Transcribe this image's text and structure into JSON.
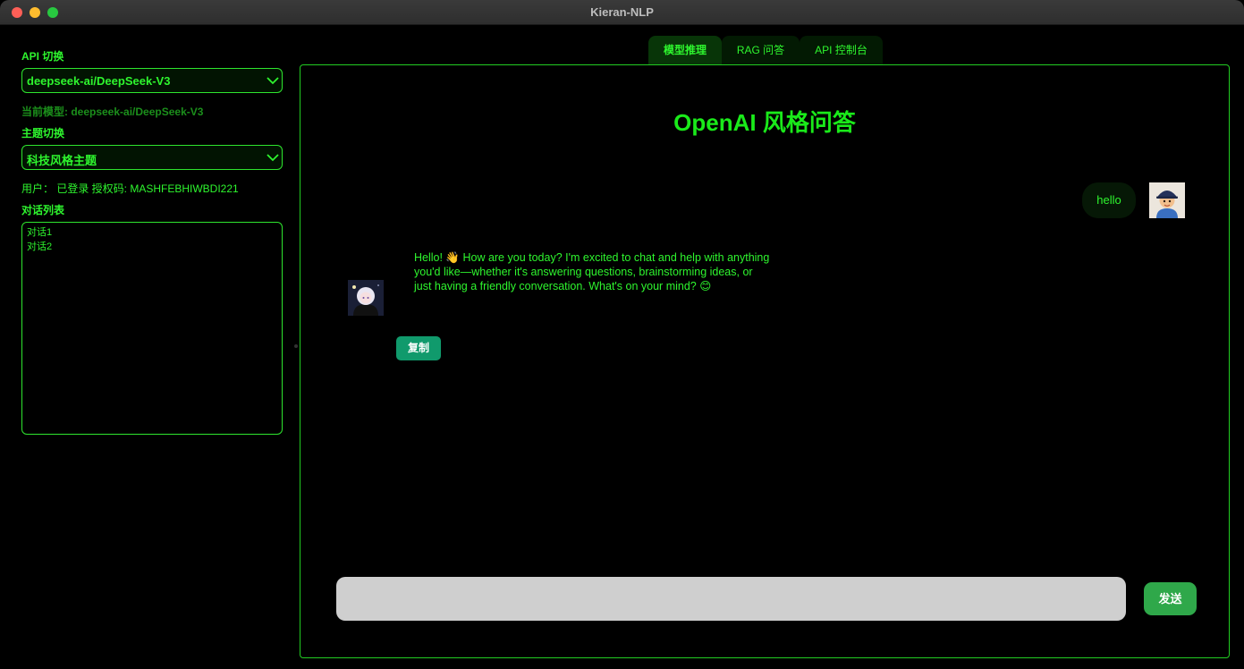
{
  "window": {
    "title": "Kieran-NLP"
  },
  "sidebar": {
    "api_label": "API 切换",
    "api_selected": "deepseek-ai/DeepSeek-V3",
    "current_model_text": "当前模型: deepseek-ai/DeepSeek-V3",
    "theme_label": "主题切换",
    "theme_selected": "科技风格主题",
    "user_info": "用户：  已登录  授权码: MASHFEBHIWBDI221",
    "conversation_label": "对话列表",
    "conversations": [
      "对话1",
      "对话2"
    ]
  },
  "tabs": [
    {
      "label": "模型推理",
      "active": true
    },
    {
      "label": "RAG 问答",
      "active": false
    },
    {
      "label": "API 控制台",
      "active": false
    }
  ],
  "main": {
    "title": "OpenAI 风格问答",
    "user_message": "hello",
    "bot_message": "Hello! 👋 How are you today? I'm excited to chat and help with anything you'd like—whether it's answering questions, brainstorming ideas, or just having a friendly conversation. What's on your mind? 😊",
    "copy_label": "复制",
    "input_value": "",
    "send_label": "发送"
  },
  "colors": {
    "accent": "#22ee22",
    "send": "#2fa84a",
    "copy": "#109a6c"
  }
}
